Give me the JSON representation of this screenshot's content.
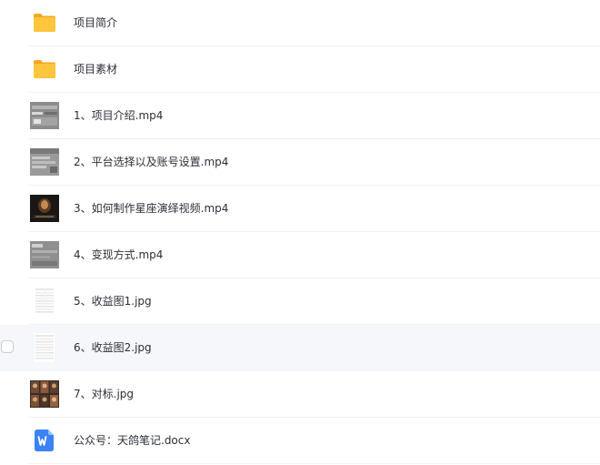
{
  "files": [
    {
      "name": "项目简介",
      "type": "folder",
      "icon": "folder-icon"
    },
    {
      "name": "项目素材",
      "type": "folder",
      "icon": "folder-icon"
    },
    {
      "name": "1、项目介绍.mp4",
      "type": "video",
      "icon": "video-thumbnail"
    },
    {
      "name": "2、平台选择以及账号设置.mp4",
      "type": "video",
      "icon": "video-thumbnail"
    },
    {
      "name": "3、如何制作星座演绎视频.mp4",
      "type": "video",
      "icon": "video-thumbnail"
    },
    {
      "name": "4、变现方式.mp4",
      "type": "video",
      "icon": "video-thumbnail"
    },
    {
      "name": "5、收益图1.jpg",
      "type": "image",
      "icon": "image-thumbnail"
    },
    {
      "name": "6、收益图2.jpg",
      "type": "image",
      "icon": "image-thumbnail",
      "hovered": true
    },
    {
      "name": "7、对标.jpg",
      "type": "image",
      "icon": "image-thumbnail"
    },
    {
      "name": "公众号：天鸽笔记.docx",
      "type": "docx",
      "icon": "word-doc-icon"
    }
  ],
  "colors": {
    "folder": "#ffc53d",
    "folder_dark": "#f5a623",
    "word": "#3b82f6",
    "hover_row": "#f5f7fb",
    "text": "#2b2f36"
  }
}
